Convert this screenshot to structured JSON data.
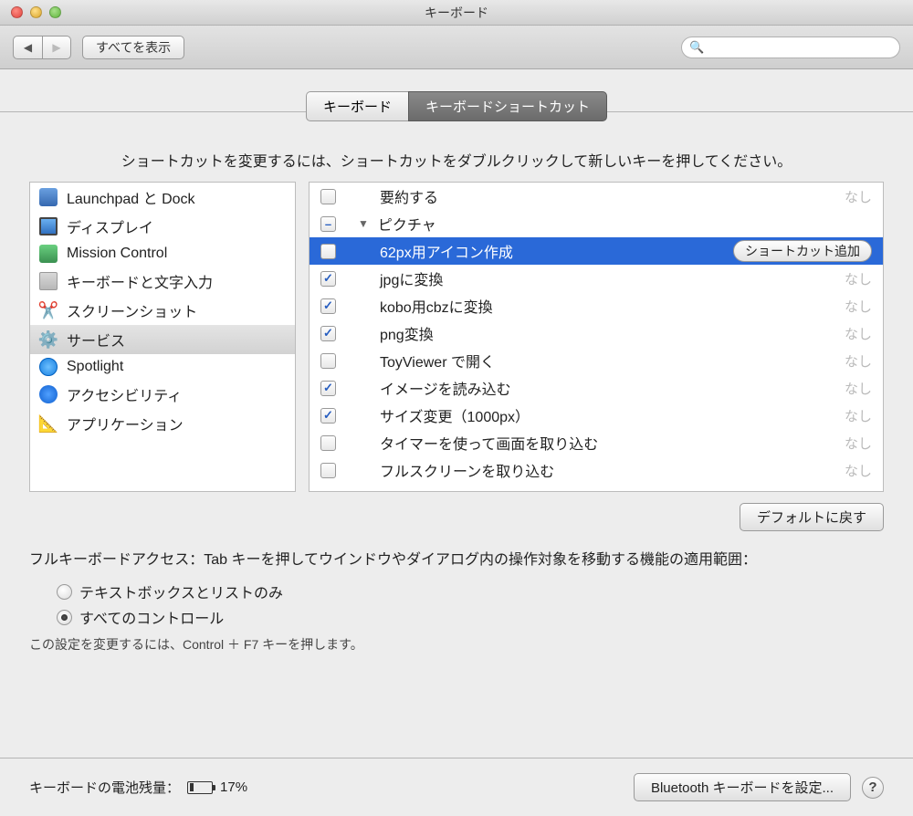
{
  "window": {
    "title": "キーボード"
  },
  "toolbar": {
    "show_all": "すべてを表示",
    "search_placeholder": ""
  },
  "tabs": {
    "keyboard": "キーボード",
    "shortcuts": "キーボードショートカット"
  },
  "instruction": "ショートカットを変更するには、ショートカットをダブルクリックして新しいキーを押してください。",
  "sidebar": {
    "items": [
      {
        "label": "Launchpad と Dock",
        "icon": "launchpad"
      },
      {
        "label": "ディスプレイ",
        "icon": "display"
      },
      {
        "label": "Mission Control",
        "icon": "mission"
      },
      {
        "label": "キーボードと文字入力",
        "icon": "keyboard"
      },
      {
        "label": "スクリーンショット",
        "icon": "screenshot"
      },
      {
        "label": "サービス",
        "icon": "services",
        "selected": true
      },
      {
        "label": "Spotlight",
        "icon": "spotlight"
      },
      {
        "label": "アクセシビリティ",
        "icon": "accessibility"
      },
      {
        "label": "アプリケーション",
        "icon": "apps"
      }
    ]
  },
  "detail": {
    "rows": [
      {
        "checked": false,
        "label": "要約する",
        "indent": 1,
        "shortcut": "なし"
      },
      {
        "checked": "mixed",
        "label": "ピクチャ",
        "indent": 0,
        "group": true
      },
      {
        "checked": false,
        "label": "62px用アイコン作成",
        "indent": 1,
        "selected": true,
        "add_shortcut": "ショートカット追加"
      },
      {
        "checked": true,
        "label": "jpgに変換",
        "indent": 1,
        "shortcut": "なし"
      },
      {
        "checked": true,
        "label": "kobo用cbzに変換",
        "indent": 1,
        "shortcut": "なし"
      },
      {
        "checked": true,
        "label": "png変換",
        "indent": 1,
        "shortcut": "なし"
      },
      {
        "checked": false,
        "label": "ToyViewer で開く",
        "indent": 1,
        "shortcut": "なし"
      },
      {
        "checked": true,
        "label": "イメージを読み込む",
        "indent": 1,
        "shortcut": "なし"
      },
      {
        "checked": true,
        "label": "サイズ変更（1000px）",
        "indent": 1,
        "shortcut": "なし"
      },
      {
        "checked": false,
        "label": "タイマーを使って画面を取り込む",
        "indent": 1,
        "shortcut": "なし"
      },
      {
        "checked": false,
        "label": "フルスクリーンを取り込む",
        "indent": 1,
        "shortcut": "なし"
      }
    ]
  },
  "reset_button": "デフォルトに戻す",
  "fka": {
    "label": "フルキーボードアクセス：Tab キーを押してウインドウやダイアログ内の操作対象を移動する機能の適用範囲：",
    "option_text": "テキストボックスとリストのみ",
    "option_all": "すべてのコントロール",
    "selected": "all",
    "hint": "この設定を変更するには、Control ＋ F7 キーを押します。"
  },
  "footer": {
    "battery_label": "キーボードの電池残量：",
    "battery_percent": "17%",
    "bluetooth_button": "Bluetooth キーボードを設定...",
    "help": "?"
  }
}
